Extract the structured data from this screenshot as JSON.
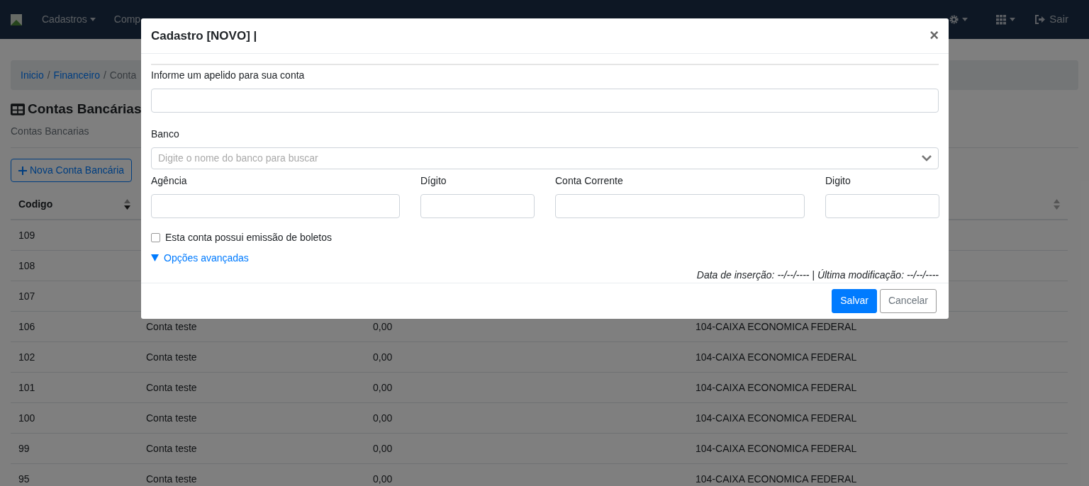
{
  "navbar": {
    "menus": [
      {
        "label": "Cadastros",
        "caret": true
      },
      {
        "label": "Comp",
        "caret": false
      }
    ],
    "logout": "Sair"
  },
  "breadcrumb": [
    {
      "label": "Inicio",
      "link": true
    },
    {
      "separator": "/",
      "label": "Financeiro",
      "link": true
    },
    {
      "separator": "/",
      "label": "Conta",
      "link": false
    }
  ],
  "page": {
    "title": "Contas Bancárias",
    "subtitle": "Contas Bancarias",
    "new_button": "Nova Conta Bancária"
  },
  "table": {
    "columns": [
      {
        "label": "Codigo",
        "sorted": true
      },
      {
        "sorted": false
      }
    ],
    "rows": [
      {
        "cells": [
          "109"
        ]
      },
      {
        "cells": [
          "108"
        ]
      },
      {
        "cells": [
          "107"
        ]
      },
      {
        "cells": [
          "106",
          "Conta teste",
          "0,00",
          "104-CAIXA ECONOMICA FEDERAL"
        ]
      },
      {
        "cells": [
          "102",
          "Conta teste",
          "0,00",
          "104-CAIXA ECONOMICA FEDERAL"
        ]
      },
      {
        "cells": [
          "101",
          "Conta teste",
          "0,00",
          "104-CAIXA ECONOMICA FEDERAL"
        ]
      },
      {
        "cells": [
          "100",
          "Conta teste",
          "0,00",
          "104-CAIXA ECONOMICA FEDERAL"
        ]
      },
      {
        "cells": [
          "99",
          "Conta teste",
          "0,00",
          "104-CAIXA ECONOMICA FEDERAL"
        ]
      },
      {
        "cells": [
          "95",
          "Conta teste",
          "0,00",
          "104-CAIXA ECONOMICA FEDERAL"
        ]
      }
    ]
  },
  "modal": {
    "title": "Cadastro [NOVO] |",
    "close": "×",
    "nickname": {
      "label": "Informe um apelido para sua conta"
    },
    "bank": {
      "label": "Banco",
      "placeholder": "Digite o nome do banco para buscar"
    },
    "account_fields": [
      {
        "label": "Agência"
      },
      {
        "label": "Dígito"
      },
      {
        "label": "Conta Corrente"
      },
      {
        "label": "Digito"
      }
    ],
    "boleto": {
      "label": "Esta conta possui emissão de boletos",
      "checked": false
    },
    "advanced": {
      "label": "Opções avançadas",
      "expanded": false
    },
    "dates": "Data de inserção: --/--/---- | Última modificação: --/--/----",
    "buttons": [
      {
        "label": "Salvar",
        "kind": "primary"
      },
      {
        "label": "Cancelar",
        "kind": "secondary"
      }
    ]
  }
}
